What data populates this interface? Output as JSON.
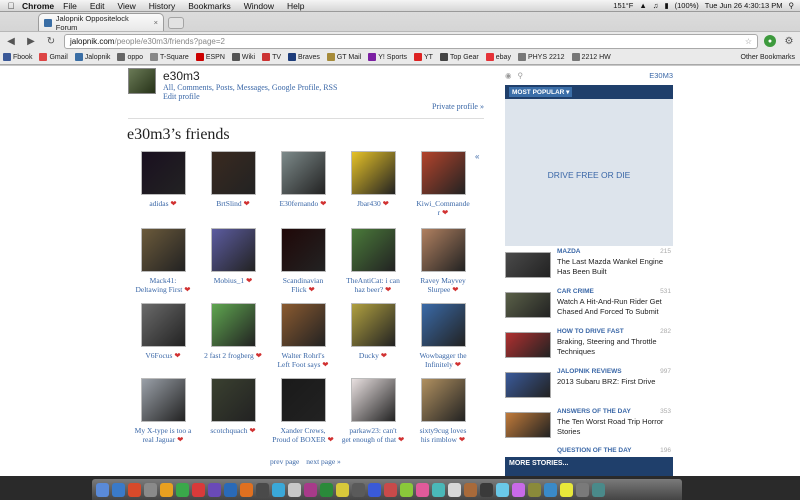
{
  "menubar": {
    "app": "Chrome",
    "items": [
      "File",
      "Edit",
      "View",
      "History",
      "Bookmarks",
      "Window",
      "Help"
    ],
    "temperature": "151°F",
    "battery": "(100%)",
    "datetime": "Tue Jun 26  4:30:13 PM"
  },
  "tab": {
    "title": "Jalopnik Oppositelock Forum",
    "close": "×"
  },
  "omnibox": {
    "host": "jalopnik.com",
    "path": "/people/e30m3/friends?page=2",
    "star": "☆"
  },
  "bookmarks": [
    {
      "label": "Fbook",
      "color": "#3b5998"
    },
    {
      "label": "Gmail",
      "color": "#d44"
    },
    {
      "label": "Jalopnik",
      "color": "#3a6ea5"
    },
    {
      "label": "oppo",
      "color": "#666"
    },
    {
      "label": "T-Square",
      "color": "#888"
    },
    {
      "label": "ESPN",
      "color": "#c00"
    },
    {
      "label": "Wiki",
      "color": "#555"
    },
    {
      "label": "TV",
      "color": "#c33"
    },
    {
      "label": "Braves",
      "color": "#1d3c7a"
    },
    {
      "label": "GT Mail",
      "color": "#a68b3a"
    },
    {
      "label": "Y! Sports",
      "color": "#7b1fa2"
    },
    {
      "label": "YT",
      "color": "#d22"
    },
    {
      "label": "Top Gear",
      "color": "#444"
    },
    {
      "label": "ebay",
      "color": "#e53238"
    },
    {
      "label": "PHYS 2212",
      "color": "#777"
    },
    {
      "label": "2212 HW",
      "color": "#777"
    }
  ],
  "other_bookmarks": "Other Bookmarks",
  "profile": {
    "name": "e30m3",
    "links": "All, Comments, Posts, Messages, Google Profile, RSS",
    "edit": "Edit profile",
    "private": "Private profile »"
  },
  "friends": {
    "heading": "e30m3’s friends",
    "arrow": "«",
    "heart": "❤",
    "list": [
      {
        "line1": "adidas",
        "line2": "",
        "color": "#1a1020"
      },
      {
        "line1": "BrtSlind",
        "line2": "",
        "color": "#3a2a20"
      },
      {
        "line1": "E30fernando",
        "line2": "",
        "color": "#7d8a8a"
      },
      {
        "line1": "Jbar430",
        "line2": "",
        "color": "#e6c228"
      },
      {
        "line1": "Kiwi_Commande",
        "line2": "r",
        "color": "#b3442c"
      },
      {
        "line1": "Mack41:",
        "line2": "Deltawing First",
        "color": "#6b5a3b"
      },
      {
        "line1": "Mobius_1",
        "line2": "",
        "color": "#5c5ca0"
      },
      {
        "line1": "Scandinavian",
        "line2": "Flick",
        "color": "#200808"
      },
      {
        "line1": "TheAntiCat: i can",
        "line2": "haz beer?",
        "color": "#4a7a3a"
      },
      {
        "line1": "Ravey Mayvey",
        "line2": "Slurpee",
        "color": "#b08060"
      },
      {
        "line1": "V6Focus",
        "line2": "",
        "color": "#6a6a6a"
      },
      {
        "line1": "2 fast 2 frogberg",
        "line2": "",
        "color": "#5fa650"
      },
      {
        "line1": "Walter Rohrl's",
        "line2": "Left Foot says",
        "color": "#8a5a30"
      },
      {
        "line1": "Ducky",
        "line2": "",
        "color": "#b0a040"
      },
      {
        "line1": "Wowbagger the",
        "line2": "Infinitely",
        "color": "#3a6aa8"
      },
      {
        "line1": "My X-type is too a",
        "line2": "real Jaguar",
        "color": "#9aa0a8"
      },
      {
        "line1": "scotchquach",
        "line2": "",
        "color": "#3a4030"
      },
      {
        "line1": "Xander Crews,",
        "line2": "Proud of BOXER",
        "color": "#1a1a1a"
      },
      {
        "line1": "parkaw23: can't",
        "line2": "get enough of that",
        "color": "#e8e0e0"
      },
      {
        "line1": "sixty9cug loves",
        "line2": "his rimblow",
        "color": "#b09060"
      }
    ]
  },
  "pager": {
    "prev": "prev page",
    "next": "next page »"
  },
  "sidebar": {
    "user": "E30M3",
    "most_popular": "MOST POPULAR ▾",
    "ad_text": "DRIVE FREE OR DIE",
    "stories": [
      {
        "category": "MAZDA",
        "count": "215",
        "title": "The Last Mazda Wankel Engine Has Been Built",
        "color": "#4a4a4a"
      },
      {
        "category": "CAR CRIME",
        "count": "531",
        "title": "Watch A Hit-And-Run Rider Get Chased And Forced To Submit",
        "color": "#5a6048"
      },
      {
        "category": "HOW TO DRIVE FAST",
        "count": "282",
        "title": "Braking, Steering and Throttle Techniques",
        "color": "#b03030"
      },
      {
        "category": "JALOPNIK REVIEWS",
        "count": "997",
        "title": "2013 Subaru BRZ: First Drive",
        "color": "#3a5a9a"
      },
      {
        "category": "ANSWERS OF THE DAY",
        "count": "353",
        "title": "The Ten Worst Road Trip Horror Stories",
        "color": "#c07a3a"
      },
      {
        "category": "QUESTION OF THE DAY",
        "count": "196",
        "title": "",
        "color": "#777"
      }
    ],
    "more": "MORE STORIES..."
  }
}
